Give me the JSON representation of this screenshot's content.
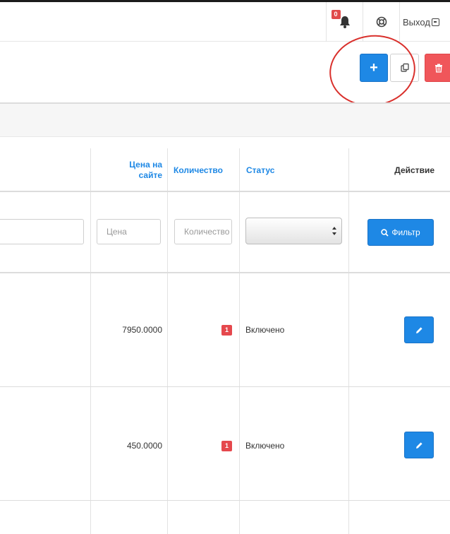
{
  "header": {
    "notification_count": "0",
    "logout_label": "Выход"
  },
  "toolbar": {
    "add_label": "+"
  },
  "table": {
    "columns": {
      "price_site": "Цена на сайте",
      "quantity": "Количество",
      "status": "Статус",
      "action": "Действие"
    },
    "filters": {
      "price_placeholder": "Цена",
      "quantity_placeholder": "Количество",
      "filter_button": "Фильтр"
    },
    "rows": [
      {
        "price": "7950.0000",
        "quantity": "1",
        "status": "Включено"
      },
      {
        "price": "450.0000",
        "quantity": "1",
        "status": "Включено"
      }
    ]
  },
  "colors": {
    "primary": "#1e88e5",
    "danger": "#f0565a",
    "annotation": "#d9302c"
  }
}
